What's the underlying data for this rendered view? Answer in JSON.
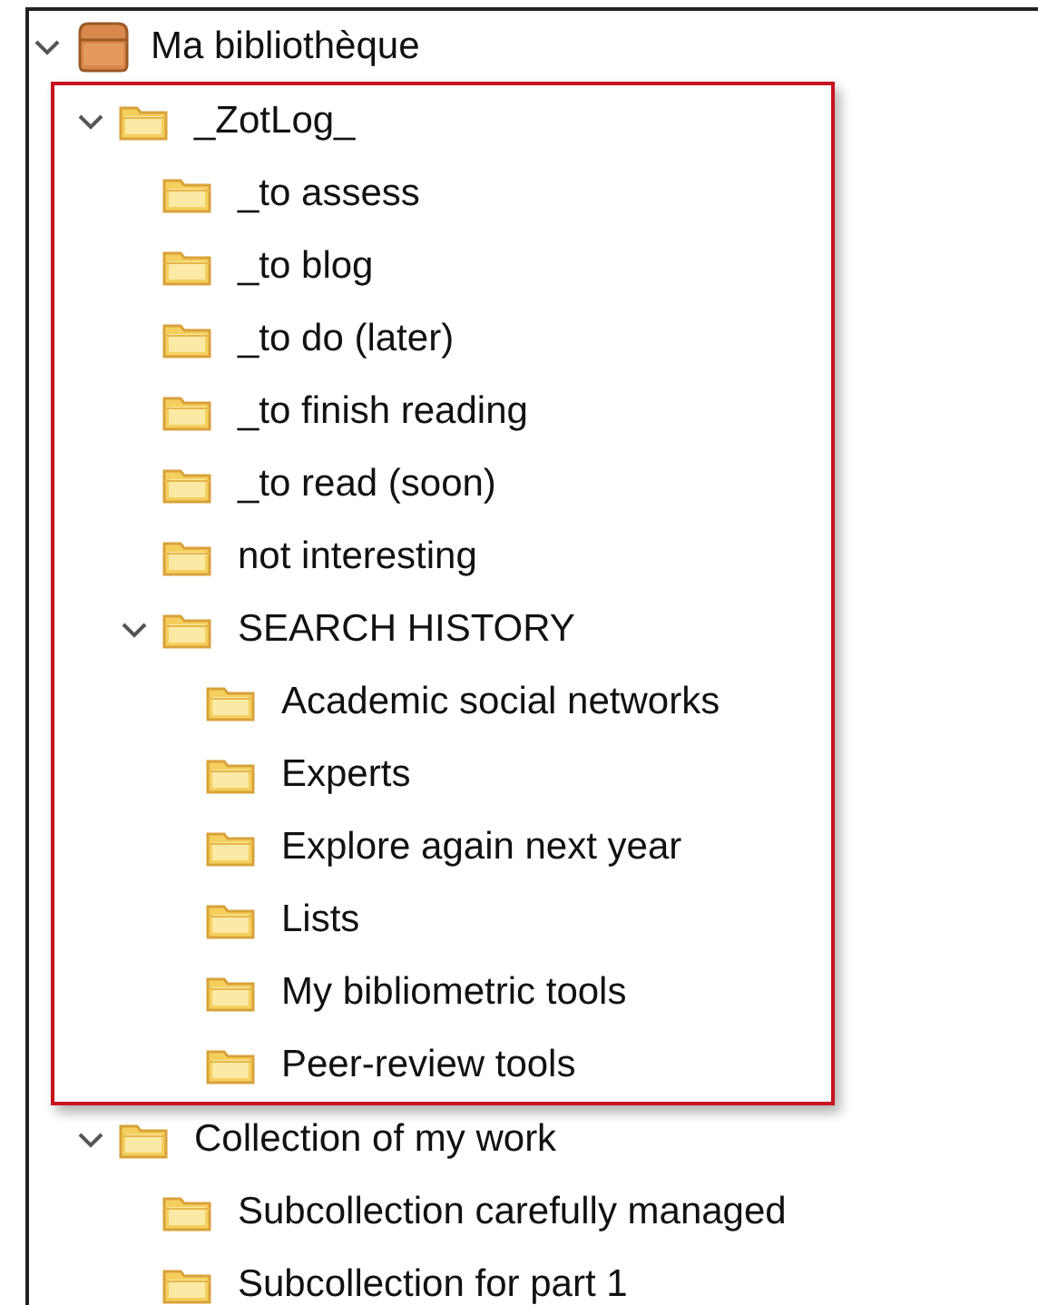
{
  "tree": [
    {
      "label": "Ma bibliothèque",
      "kind": "library",
      "expanded": true,
      "children": [
        {
          "label": "_ZotLog_",
          "kind": "folder",
          "expanded": true,
          "highlighted": true,
          "children": [
            {
              "label": "_to assess",
              "kind": "folder"
            },
            {
              "label": "_to blog",
              "kind": "folder"
            },
            {
              "label": "_to do (later)",
              "kind": "folder"
            },
            {
              "label": "_to finish reading",
              "kind": "folder"
            },
            {
              "label": "_to read (soon)",
              "kind": "folder"
            },
            {
              "label": "not interesting",
              "kind": "folder"
            },
            {
              "label": "SEARCH HISTORY",
              "kind": "folder",
              "expanded": true,
              "children": [
                {
                  "label": "Academic social networks",
                  "kind": "folder"
                },
                {
                  "label": "Experts",
                  "kind": "folder"
                },
                {
                  "label": "Explore again next year",
                  "kind": "folder"
                },
                {
                  "label": "Lists",
                  "kind": "folder"
                },
                {
                  "label": "My bibliometric tools",
                  "kind": "folder"
                },
                {
                  "label": "Peer-review tools",
                  "kind": "folder"
                }
              ]
            }
          ]
        },
        {
          "label": "Collection of my work",
          "kind": "folder",
          "expanded": true,
          "children": [
            {
              "label": "Subcollection carefully managed",
              "kind": "folder"
            },
            {
              "label": "Subcollection for part 1",
              "kind": "folder"
            }
          ]
        }
      ]
    }
  ]
}
